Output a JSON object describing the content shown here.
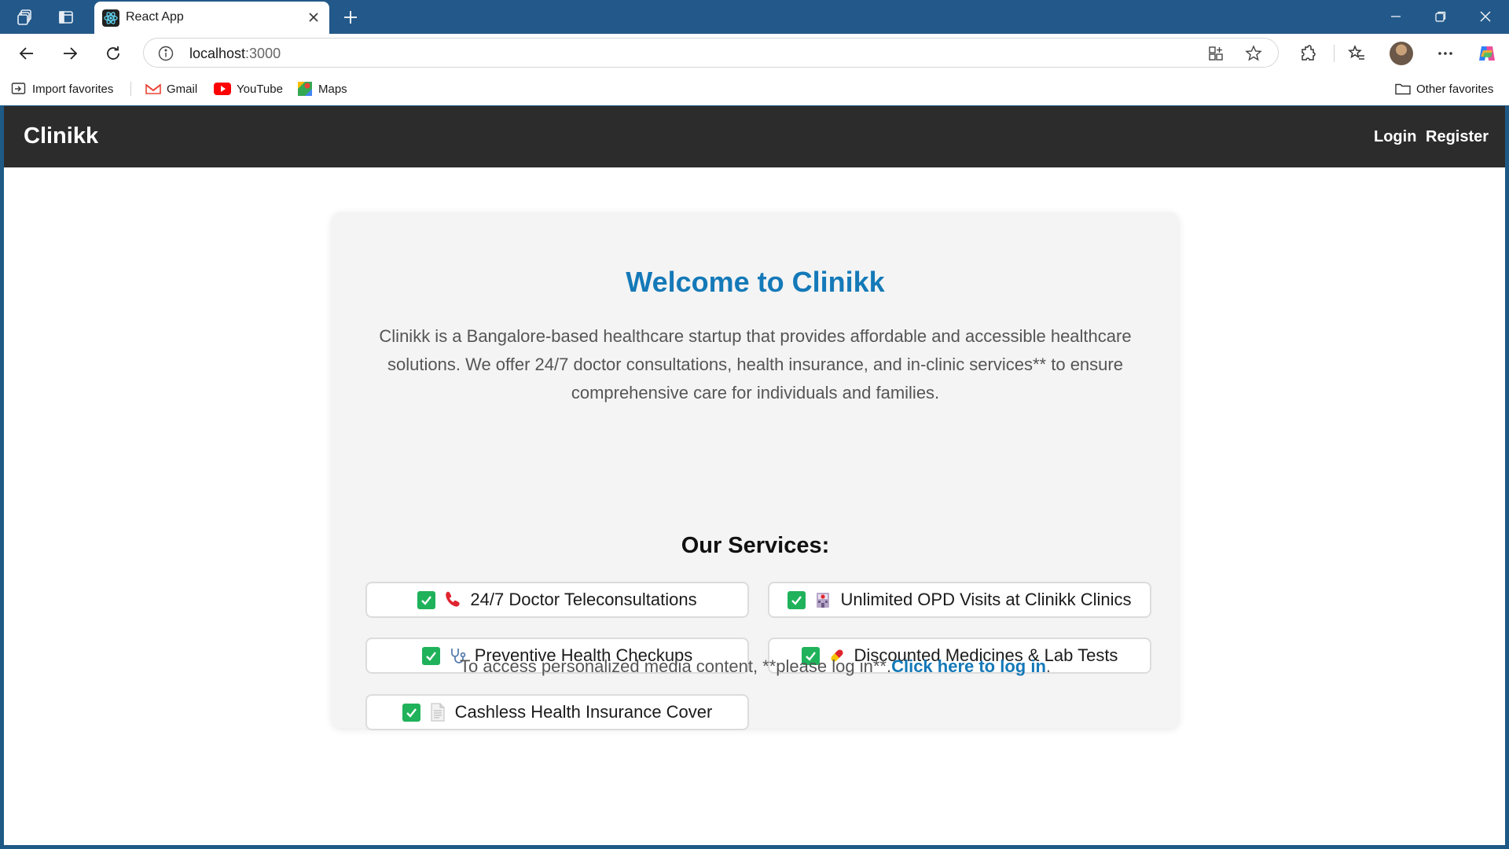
{
  "browser": {
    "tab_title": "React App",
    "url_host": "localhost",
    "url_port": ":3000",
    "bookmarks": [
      {
        "label": "Import favorites"
      },
      {
        "label": "Gmail"
      },
      {
        "label": "YouTube"
      },
      {
        "label": "Maps"
      }
    ],
    "other_favorites": "Other favorites"
  },
  "navbar": {
    "brand": "Clinikk",
    "login": "Login",
    "register": "Register"
  },
  "main": {
    "title": "Welcome to Clinikk",
    "description": "Clinikk is a Bangalore-based healthcare startup that provides affordable and accessible healthcare solutions. We offer 24/7 doctor consultations, health insurance, and in-clinic services** to ensure comprehensive care for individuals and families.",
    "services_title": "Our Services:",
    "services": [
      {
        "label": "24/7 Doctor Teleconsultations",
        "icon": "telephone-icon"
      },
      {
        "label": "Unlimited OPD Visits at Clinikk Clinics",
        "icon": "hospital-icon"
      },
      {
        "label": "Preventive Health Checkups",
        "icon": "stethoscope-icon"
      },
      {
        "label": "Discounted Medicines & Lab Tests",
        "icon": "pill-icon"
      },
      {
        "label": "Cashless Health Insurance Cover",
        "icon": "document-icon"
      }
    ],
    "login_note_prefix": "To access personalized media content, **please log in**.",
    "login_link": "Click here to log in",
    "login_note_suffix": "."
  },
  "colors": {
    "accent": "#1479b8",
    "navbar_bg": "#2c2c2c",
    "check_green": "#1fb25a",
    "browser_frame": "#23598a"
  }
}
